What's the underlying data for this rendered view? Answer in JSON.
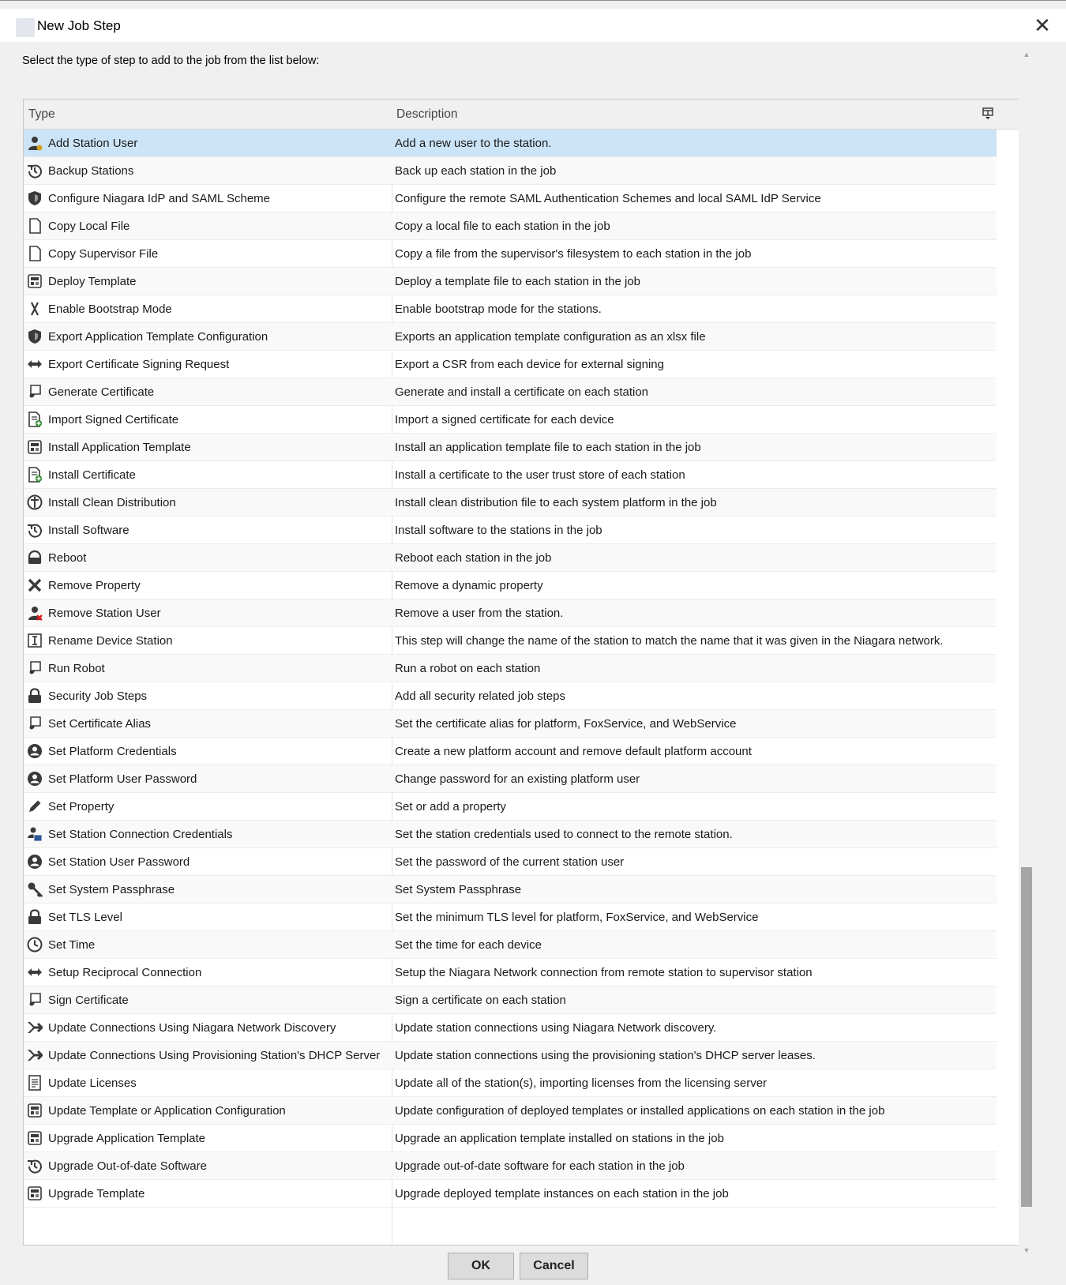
{
  "window": {
    "title": "New Job Step",
    "close_glyph": "✕"
  },
  "instruction": "Select the type of step to add to the job from the list below:",
  "table": {
    "columns": {
      "type": "Type",
      "description": "Description"
    },
    "rows": [
      {
        "icon": "user-add-icon",
        "type": "Add Station User",
        "description": "Add a new user to the station.",
        "selected": true
      },
      {
        "icon": "history-icon",
        "type": "Backup Stations",
        "description": "Back up each station in the job"
      },
      {
        "icon": "shield-icon",
        "type": "Configure Niagara IdP and SAML Scheme",
        "description": "Configure the remote SAML Authentication Schemes and local SAML IdP Service"
      },
      {
        "icon": "file-icon",
        "type": "Copy Local File",
        "description": "Copy a local file to each station in the job"
      },
      {
        "icon": "file-icon",
        "type": "Copy Supervisor File",
        "description": "Copy a file from the supervisor's filesystem to each station in the job"
      },
      {
        "icon": "template-icon",
        "type": "Deploy Template",
        "description": "Deploy a template file to each station in the job"
      },
      {
        "icon": "bootstrap-icon",
        "type": "Enable Bootstrap Mode",
        "description": "Enable bootstrap mode for the stations."
      },
      {
        "icon": "shield-icon",
        "type": "Export Application Template Configuration",
        "description": "Exports an application template configuration as an xlsx file"
      },
      {
        "icon": "arrows-icon",
        "type": "Export Certificate Signing Request",
        "description": "Export a CSR from each device for external signing"
      },
      {
        "icon": "certificate-icon",
        "type": "Generate Certificate",
        "description": "Generate and install a certificate on each station"
      },
      {
        "icon": "document-add-icon",
        "type": "Import Signed Certificate",
        "description": "Import a signed certificate for each device"
      },
      {
        "icon": "template-icon",
        "type": "Install Application Template",
        "description": "Install an application template file to each station in the job"
      },
      {
        "icon": "document-add-icon",
        "type": "Install Certificate",
        "description": "Install a certificate to the user trust store of each station"
      },
      {
        "icon": "distribution-icon",
        "type": "Install Clean Distribution",
        "description": "Install clean distribution file to each system platform in the job"
      },
      {
        "icon": "history-icon",
        "type": "Install Software",
        "description": "Install software to the stations in the job"
      },
      {
        "icon": "reboot-icon",
        "type": "Reboot",
        "description": "Reboot each station in the job"
      },
      {
        "icon": "close-x-icon",
        "type": "Remove Property",
        "description": "Remove a dynamic property"
      },
      {
        "icon": "user-remove-icon",
        "type": "Remove Station User",
        "description": "Remove a user from the station."
      },
      {
        "icon": "rename-icon",
        "type": "Rename Device Station",
        "description": "This step will change the name of the station to match the name that it was given in the Niagara network."
      },
      {
        "icon": "certificate-icon",
        "type": "Run Robot",
        "description": "Run a robot on each station"
      },
      {
        "icon": "lock-icon",
        "type": "Security Job Steps",
        "description": "Add all security related job steps"
      },
      {
        "icon": "certificate-icon",
        "type": "Set Certificate Alias",
        "description": "Set the certificate alias for platform, FoxService, and WebService"
      },
      {
        "icon": "account-icon",
        "type": "Set Platform Credentials",
        "description": "Create a new platform account and remove default platform account"
      },
      {
        "icon": "account-icon",
        "type": "Set Platform User Password",
        "description": "Change password for an existing platform user"
      },
      {
        "icon": "pencil-icon",
        "type": "Set Property",
        "description": "Set or add a property"
      },
      {
        "icon": "credentials-icon",
        "type": "Set Station Connection Credentials",
        "description": "Set the station credentials used to connect to the remote station."
      },
      {
        "icon": "account-icon",
        "type": "Set Station User Password",
        "description": "Set the password of the current station user"
      },
      {
        "icon": "key-icon",
        "type": "Set System Passphrase",
        "description": "Set System Passphrase"
      },
      {
        "icon": "lock-icon",
        "type": "Set TLS Level",
        "description": "Set the minimum TLS level for platform, FoxService, and WebService"
      },
      {
        "icon": "clock-icon",
        "type": "Set Time",
        "description": "Set the time for each device"
      },
      {
        "icon": "arrows-icon",
        "type": "Setup Reciprocal Connection",
        "description": "Setup the Niagara Network connection from remote station to supervisor station"
      },
      {
        "icon": "certificate-icon",
        "type": "Sign Certificate",
        "description": "Sign a certificate on each station"
      },
      {
        "icon": "merge-icon",
        "type": "Update Connections Using Niagara Network Discovery",
        "description": "Update station connections using Niagara Network discovery."
      },
      {
        "icon": "merge-icon",
        "type": "Update Connections Using Provisioning Station's DHCP Server",
        "description": "Update station connections using the provisioning station's DHCP server leases."
      },
      {
        "icon": "license-icon",
        "type": "Update Licenses",
        "description": "Update all of the station(s), importing licenses from the licensing server"
      },
      {
        "icon": "template-icon",
        "type": "Update Template or Application Configuration",
        "description": "Update configuration of deployed templates or installed applications on each station in the job"
      },
      {
        "icon": "template-icon",
        "type": "Upgrade Application Template",
        "description": "Upgrade an application template installed on stations in the job"
      },
      {
        "icon": "history-icon",
        "type": "Upgrade Out-of-date Software",
        "description": "Upgrade out-of-date software for each station in the job"
      },
      {
        "icon": "template-icon",
        "type": "Upgrade Template",
        "description": "Upgrade deployed template instances on each station in the job"
      }
    ]
  },
  "buttons": {
    "ok": "OK",
    "cancel": "Cancel"
  },
  "colors": {
    "selected_row": "#cce4f7",
    "window_bg": "#f0f0f0",
    "icon": "#3a3a3a"
  }
}
